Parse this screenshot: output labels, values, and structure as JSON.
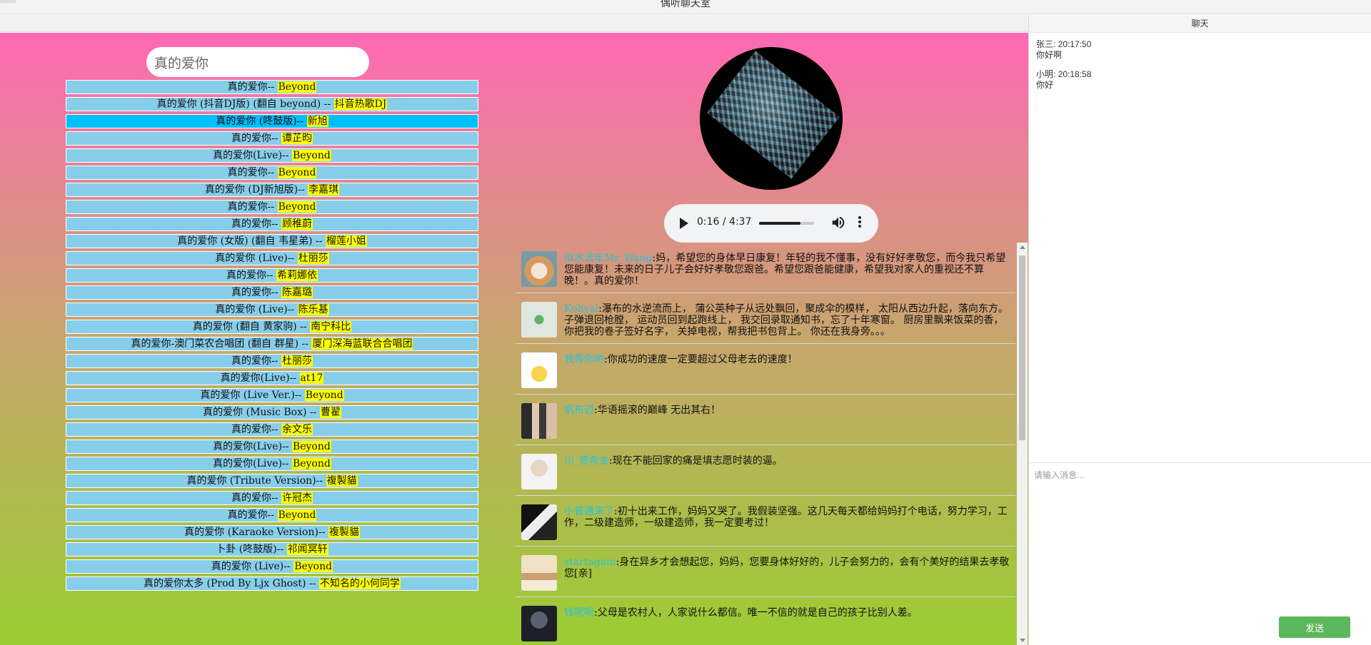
{
  "window": {
    "title": "偶听聊天室"
  },
  "search": {
    "value": "真的爱你"
  },
  "songs": [
    {
      "title": "真的爱你-- ",
      "artist": "Beyond"
    },
    {
      "title": "真的爱你 (抖音DJ版) (翻自 beyond) -- ",
      "artist": "抖音热歌DJ"
    },
    {
      "title": "真的爱你 (咚鼓版)-- ",
      "artist": "新旭"
    },
    {
      "title": "真的爱你-- ",
      "artist": "谭芷昀"
    },
    {
      "title": "真的爱你(Live)-- ",
      "artist": "Beyond"
    },
    {
      "title": "真的爱你-- ",
      "artist": "Beyond"
    },
    {
      "title": "真的爱你 (DJ新旭版)-- ",
      "artist": "李嘉琪"
    },
    {
      "title": "真的爱你-- ",
      "artist": "Beyond"
    },
    {
      "title": "真的爱你-- ",
      "artist": "顾稚蔚"
    },
    {
      "title": "真的爱你 (女版) (翻自 韦星弟) -- ",
      "artist": "榴莲小姐"
    },
    {
      "title": "真的爱你 (Live)-- ",
      "artist": "杜丽莎"
    },
    {
      "title": "真的爱你-- ",
      "artist": "希莉娜依"
    },
    {
      "title": "真的爱你-- ",
      "artist": "陈嘉璐"
    },
    {
      "title": "真的爱你 (Live)-- ",
      "artist": "陈乐基"
    },
    {
      "title": "真的爱你 (翻自 黄家驹) -- ",
      "artist": "南宁科比"
    },
    {
      "title": "真的爱你-澳门菜农合唱团 (翻自 群星) -- ",
      "artist": "厦门深海蓝联合合唱团"
    },
    {
      "title": "真的爱你-- ",
      "artist": "杜丽莎"
    },
    {
      "title": "真的爱你(Live)-- ",
      "artist": "at17"
    },
    {
      "title": "真的爱你 (Live Ver.)-- ",
      "artist": "Beyond"
    },
    {
      "title": "真的爱你 (Music Box) -- ",
      "artist": "曹翟"
    },
    {
      "title": "真的爱你-- ",
      "artist": "余文乐"
    },
    {
      "title": "真的爱你(Live)-- ",
      "artist": "Beyond"
    },
    {
      "title": "真的爱你(Live)-- ",
      "artist": "Beyond"
    },
    {
      "title": "真的爱你 (Tribute Version)-- ",
      "artist": "複製貓"
    },
    {
      "title": "真的爱你-- ",
      "artist": "许冠杰"
    },
    {
      "title": "真的爱你-- ",
      "artist": "Beyond"
    },
    {
      "title": "真的爱你 (Karaoke Version)-- ",
      "artist": "複製貓"
    },
    {
      "title": "卜卦 (咚鼓版)-- ",
      "artist": "祁闻冥轩"
    },
    {
      "title": "真的爱你 (Live)-- ",
      "artist": "Beyond"
    },
    {
      "title": "真的爱你太多 (Prod By Ljx Ghost) -- ",
      "artist": "不知名的小何同学"
    }
  ],
  "active_song_index": 2,
  "player": {
    "time": "0:16 / 4:37",
    "progress": 0.058,
    "volume": 0.75
  },
  "comments": [
    {
      "user": "似水流年Mr_Wang",
      "text": ":妈，希望您的身体早日康复！年轻的我不懂事，没有好好孝敬您，而今我只希望您能康复！未来的日子儿子会好好孝敬您跟爸。希望您跟爸能健康，希望我对家人的重视还不算晚！。真的爱你！",
      "avatar": "cat"
    },
    {
      "user": "Kohyal",
      "text": ":瀑布的水逆流而上， 蒲公英种子从远处飘回，聚成伞的模样， 太阳从西边升起，落向东方。子弹退回枪膛， 运动员回到起跑线上， 我交回录取通知书，忘了十年寒窗。 厨房里飘来饭菜的香，你把我的卷子签好名字， 关掉电视，帮我把书包背上。 你还在我身旁。。。",
      "avatar": "clover"
    },
    {
      "user": "我等你哟",
      "text": ":你成功的速度一定要超过父母老去的速度！",
      "avatar": "pikachu"
    },
    {
      "user": "帆布迈",
      "text": ":华语摇滚的巅峰 无出其右！",
      "avatar": "couple"
    },
    {
      "user": "川_菅希金",
      "text": ":现在不能回家的痛是填志愿时装的逼。",
      "avatar": "boy"
    },
    {
      "user": "小普通来了",
      "text": ":初十出来工作，妈妈又哭了。我假装坚强。这几天每天都给妈妈打个电话，努力学习，工作，二级建造师，一级建造师，我一定要考过！",
      "avatar": "bw"
    },
    {
      "user": "startagain",
      "text": ":身在异乡才会想起您，妈妈，您要身体好好的，儿子会努力的，会有个美好的结果去孝敬您[亲]",
      "avatar": "shelf"
    },
    {
      "user": "钱呢呢",
      "text": ":父母是农村人，人家说什么都信。唯一不信的就是自己的孩子比别人差。",
      "avatar": "dark"
    }
  ],
  "chat": {
    "header": "聊天",
    "messages": [
      {
        "meta": "张三: 20:17:50",
        "text": "你好啊"
      },
      {
        "meta": "小明: 20:18:58",
        "text": "你好"
      }
    ],
    "input_placeholder": "请输入消息...",
    "send_label": "发送"
  },
  "colors": {
    "gradient_top": "#ff69b4",
    "gradient_bottom": "#9acd32",
    "song_row": "#87ceeb",
    "song_row_active": "#00bfff",
    "artist_highlight": "#ffff00",
    "comment_user": "#27c2d9",
    "send_button": "#5cb85c"
  }
}
